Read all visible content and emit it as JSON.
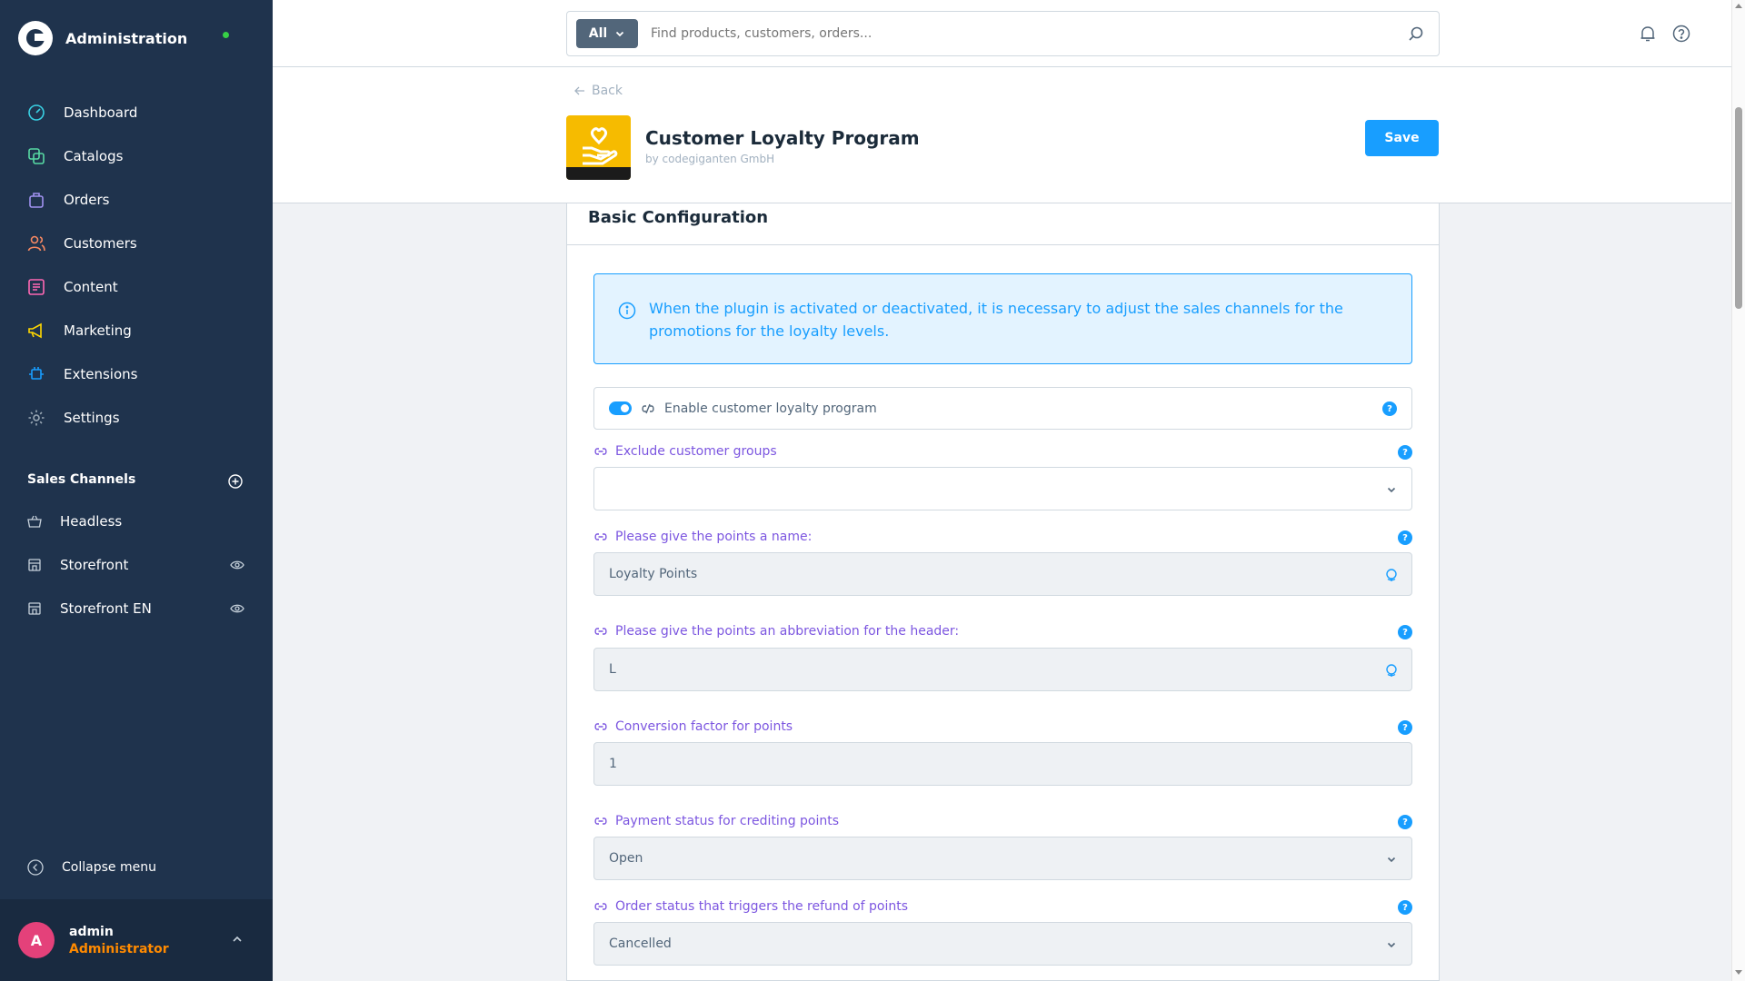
{
  "app": {
    "title": "Administration",
    "status_color": "#37d046"
  },
  "sidebar": {
    "items": [
      {
        "label": "Dashboard",
        "icon": "dashboard-icon",
        "color": "#39d0e3"
      },
      {
        "label": "Catalogs",
        "icon": "catalogs-icon",
        "color": "#57d9a3"
      },
      {
        "label": "Orders",
        "icon": "orders-icon",
        "color": "#a092f0"
      },
      {
        "label": "Customers",
        "icon": "customers-icon",
        "color": "#f88962"
      },
      {
        "label": "Content",
        "icon": "content-icon",
        "color": "#ff68b4"
      },
      {
        "label": "Marketing",
        "icon": "marketing-icon",
        "color": "#ffd700"
      },
      {
        "label": "Extensions",
        "icon": "extensions-icon",
        "color": "#189eff"
      },
      {
        "label": "Settings",
        "icon": "settings-icon",
        "color": "#9aa8b5"
      }
    ],
    "sales_channels_title": "Sales Channels",
    "sales_channels": [
      {
        "label": "Headless"
      },
      {
        "label": "Storefront"
      },
      {
        "label": "Storefront EN"
      }
    ],
    "collapse_label": "Collapse menu",
    "user": {
      "initial": "A",
      "name": "admin",
      "role": "Administrator"
    }
  },
  "topbar": {
    "search_type": "All",
    "search_placeholder": "Find products, customers, orders..."
  },
  "header": {
    "back_label": "Back",
    "plugin_name": "Customer Loyalty Program",
    "plugin_vendor": "by codegiganten GmbH",
    "save_label": "Save"
  },
  "card": {
    "title": "Basic Configuration",
    "info_text": "When the plugin is activated or deactivated, it is necessary to adjust the sales channels for the promotions for the loyalty levels.",
    "toggle_label": "Enable customer loyalty program",
    "toggle_on": true,
    "fields": [
      {
        "label": "Exclude customer groups",
        "value": ""
      },
      {
        "label": "Please give the points a name:",
        "value": "Loyalty Points"
      },
      {
        "label": "Please give the points an abbreviation for the header:",
        "value": "L"
      },
      {
        "label": "Conversion factor for points",
        "value": "1"
      },
      {
        "label": "Payment status for crediting points",
        "value": "Open"
      },
      {
        "label": "Order status that triggers the refund of points",
        "value": "Cancelled"
      }
    ],
    "help_glyph": "?"
  }
}
